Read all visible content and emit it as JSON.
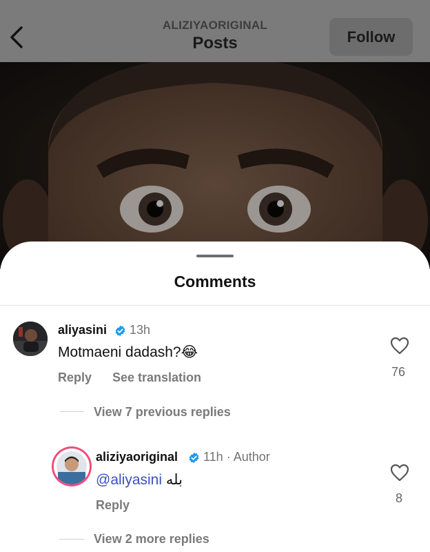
{
  "header": {
    "username": "ALIZIYAORIGINAL",
    "title": "Posts",
    "follow_label": "Follow"
  },
  "sheet": {
    "title": "Comments"
  },
  "comments": [
    {
      "username": "aliyasini",
      "time": "13h",
      "text": "Motmaeni dadash?",
      "emoji": "😂",
      "reply_label": "Reply",
      "translate_label": "See translation",
      "likes": "76"
    }
  ],
  "view_previous": "View 7 previous replies",
  "reply": {
    "username": "aliziyaoriginal",
    "time": "11h",
    "separator": "·",
    "author_badge": "Author",
    "mention": "@aliyasini",
    "text": "بله",
    "reply_label": "Reply",
    "likes": "8"
  },
  "view_more": "View 2 more replies",
  "colors": {
    "verified": "#1d9bf0",
    "mention": "#3c4fc0",
    "story_ring": "#f24d7a"
  }
}
